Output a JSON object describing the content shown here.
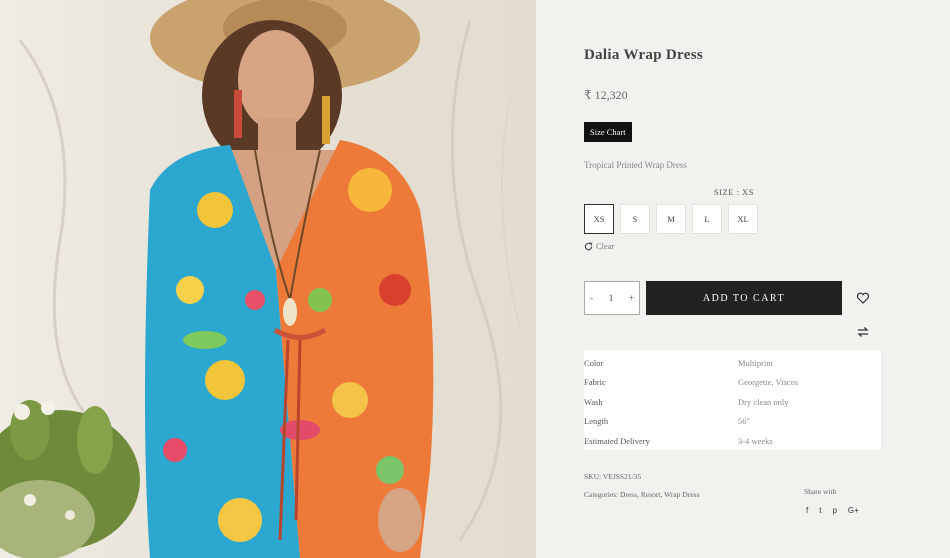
{
  "product": {
    "title": "Dalia Wrap Dress",
    "price": "₹ 12,320",
    "size_chart_label": "Size Chart",
    "short_description": "Tropical Printed Wrap Dress",
    "size_label": "SIZE : XS",
    "sizes": [
      "XS",
      "S",
      "M",
      "L",
      "XL"
    ],
    "selected_size": "XS",
    "clear_label": "Clear",
    "quantity": "1",
    "qty_minus": "-",
    "qty_plus": "+",
    "add_to_cart_label": "ADD TO CART"
  },
  "attributes": [
    {
      "key": "Color",
      "value": "Multiprint"
    },
    {
      "key": "Fabric",
      "value": "Georgette, Viscos"
    },
    {
      "key": "Wash",
      "value": "Dry clean only"
    },
    {
      "key": "Length",
      "value": "56\""
    },
    {
      "key": "Estimated Delivery",
      "value": "3-4 weeks"
    }
  ],
  "meta": {
    "sku": "SKU: VEJSS21/35",
    "categories": "Categories: Dress, Resort, Wrap Dress",
    "share_label": "Share with",
    "social_icons": [
      "facebook-icon",
      "twitter-icon",
      "pinterest-icon",
      "google-plus-icon"
    ],
    "social_glyphs": [
      "f",
      "t",
      "p",
      "G+"
    ]
  },
  "colors": {
    "page_bg": "#f3f1ed",
    "button_dark": "#222222",
    "photo_bg": "#e8e3d9"
  }
}
